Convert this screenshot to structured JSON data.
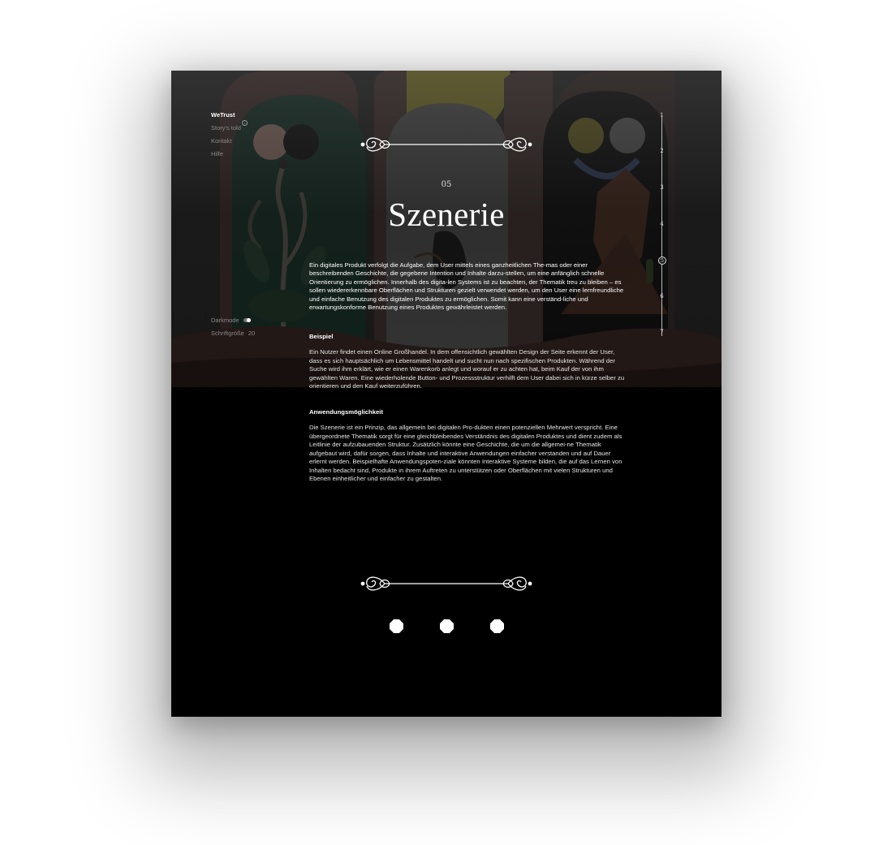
{
  "nav": {
    "brand": "WeTrust",
    "items": [
      {
        "label": "Story's told",
        "badge": "i"
      },
      {
        "label": "Kontakt"
      },
      {
        "label": "Hilfe"
      }
    ]
  },
  "settings": {
    "darkmode_label": "Darkmode",
    "darkmode_on": true,
    "fontsize_label": "Schriftgröße",
    "fontsize_value": "20"
  },
  "chapters": {
    "numbers": [
      "1",
      "2",
      "3",
      "4",
      "5",
      "6",
      "7"
    ],
    "current": "5"
  },
  "header": {
    "chapter_number": "05",
    "title": "Szenerie"
  },
  "content": {
    "intro": "Ein digitales Produkt verfolgt die Aufgabe, dem User mittels eines ganzheitlichen The-mas oder einer beschreibenden Geschichte, die gegebene Intention und Inhalte darzu-stellen, um eine anfänglich schnelle Orientierung zu ermöglichen. Innerhalb des digita-len Systems ist zu beachten, der Thematik treu zu bleiben – es sollen wiedererkennbare Oberflächen und Strukturen gezielt verwendet werden, um den User eine lernfreundliche und einfache Benutzung des digitalen Produktes zu ermöglichen. Somit kann eine verständ-liche und erwartungskonforme Benutzung eines Produktes gewährleistet werden.",
    "sections": [
      {
        "heading": "Beispiel",
        "text": "Ein Nutzer findet einen Online Großhandel. In dem offensichtlich gewählten Design der Seite erkennt der User, dass es sich hauptsächlich um Lebensmittel handelt und sucht nun nach spezifischen Produkten. Während der Suche wird ihm erklärt, wie er einen Warenkorb anlegt und worauf er zu achten hat, beim Kauf der von ihm gewählten Waren. Eine wiederholende Button- und Prozessstruktur verhilft dem User dabei sich in kürze selber zu orientieren und den Kauf weiterzuführen."
      },
      {
        "heading": "Anwendungsmöglichkeit",
        "text": "Die Szenerie ist ein Prinzip, das allgemein bei digitalen Pro-dukten einen potenziellen Mehrwert verspricht. Eine übergeordnete Thematik sorgt für eine gleichbleibendes Verständnis des digitalen Produktes und dient zudem als Leitlinie der aufzubauenden Struktur. Zusätzlich könnte eine Geschichte, die um die allgemei-ne Thematik aufgebaut wird, dafür sorgen, dass Inhalte und interaktive Anwendungen einfacher verstanden und auf Dauer erlernt werden. Beispielhafte Anwendungspoten-ziale könnten Interaktive Systeme bilden, die auf das Lernen von Inhalten bedacht sind, Produkte in ihrem Auftreten zu unterstützen oder Oberflächen mit vielen Strukturen und Ebenen einheitlicher und einfacher zu gestalten."
      }
    ]
  },
  "pagination": {
    "count": 3
  },
  "colors": {
    "page_bg": "#000000",
    "text": "#ffffff",
    "muted": "#8a8a8a",
    "arch_green": "#1d3b31",
    "arch_grey": "#6f6f6f",
    "arch_dark": "#161616",
    "sun": "#a89838",
    "terracotta": "#6b3a2a"
  },
  "icons": {
    "ornament": "ornamental-divider-icon",
    "dot": "octagon-dot-icon",
    "info": "info-icon"
  }
}
